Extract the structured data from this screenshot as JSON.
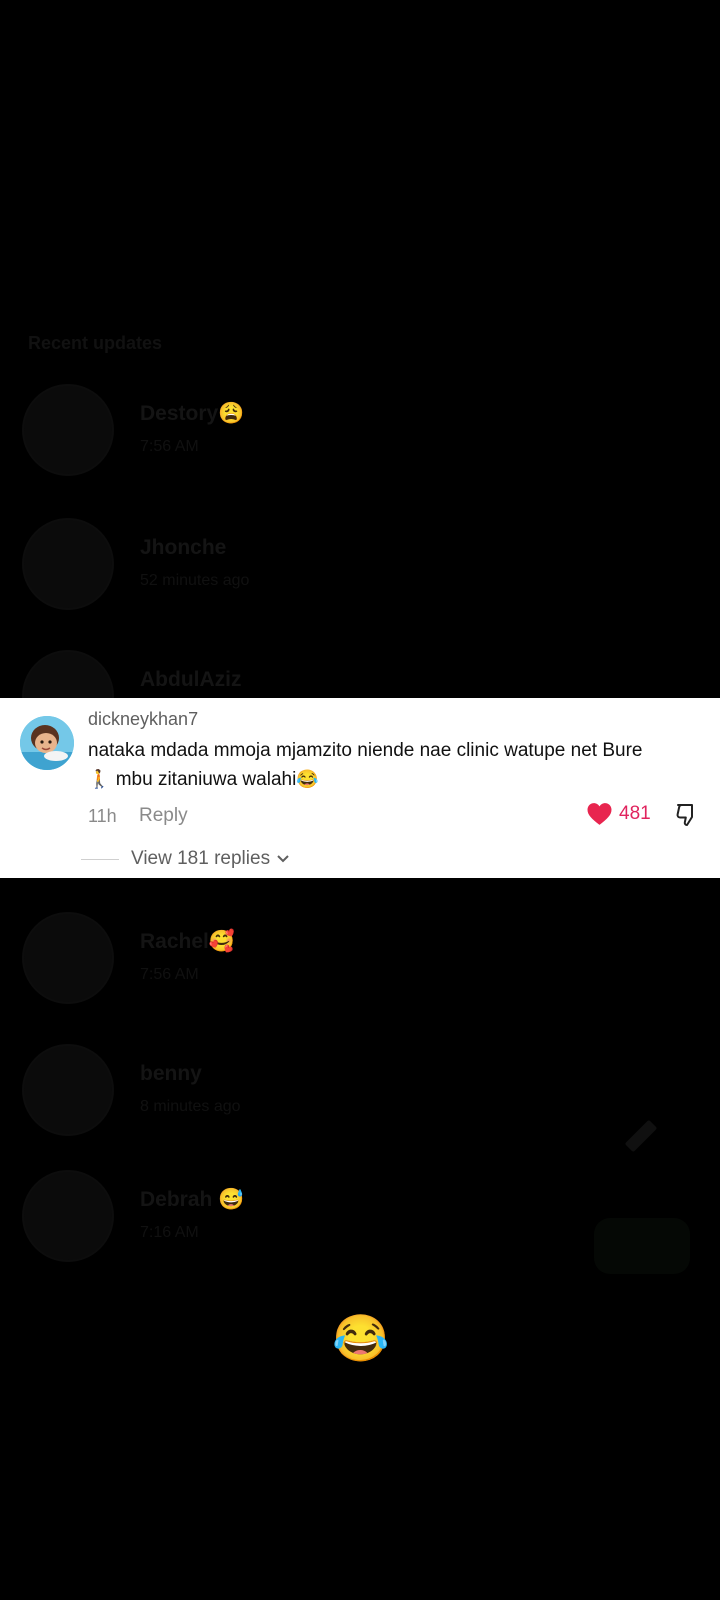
{
  "background": {
    "section_title": "Recent updates",
    "rows": [
      {
        "name": "Destory😩",
        "time": "7:56 AM"
      },
      {
        "name": "Jhonche",
        "time": "52 minutes ago"
      },
      {
        "name": "AbdulAziz",
        "time": ""
      },
      {
        "name": "Rachel🥰",
        "time": "7:56 AM"
      },
      {
        "name": "benny",
        "time": "8 minutes ago"
      },
      {
        "name": "Debrah 😅",
        "time": "7:16 AM"
      }
    ]
  },
  "comment": {
    "username": "dickneykhan7",
    "text_line1": "nataka mdada mmoja mjamzito niende nae clinic watupe net Bure",
    "text_line2_emoji": "🚶",
    "text_line2": "mbu zitaniuwa walahi",
    "text_line2_end_emoji": "😂",
    "time": "11h",
    "reply_label": "Reply",
    "likes": "481",
    "view_replies": "View 181 replies",
    "like_color": "#e0245e"
  },
  "bottom_emoji": "😂"
}
